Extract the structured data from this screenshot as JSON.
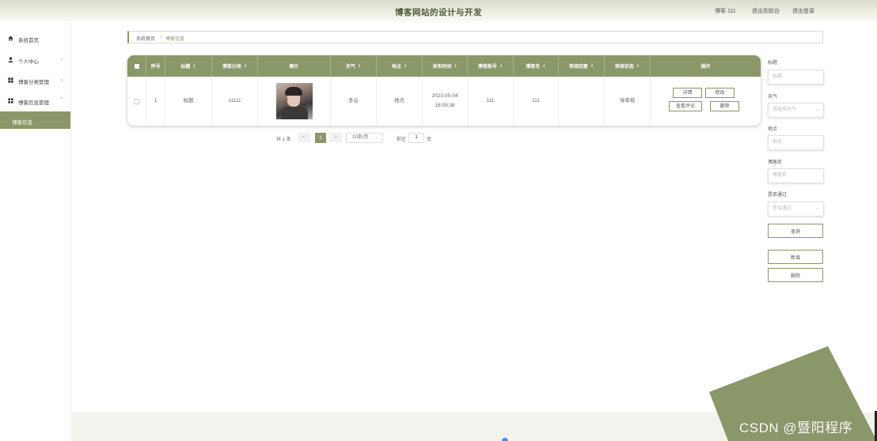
{
  "header": {
    "title": "博客网站的设计与开发",
    "user_label": "博客 111",
    "to_frontend": "退出到前台",
    "logout": "退出登录"
  },
  "sidebar": {
    "items": [
      {
        "label": "系统首页",
        "icon": "home-icon",
        "expandable": false
      },
      {
        "label": "个人中心",
        "icon": "user-icon",
        "expandable": true
      },
      {
        "label": "博客分类管理",
        "icon": "grid-icon",
        "expandable": true
      },
      {
        "label": "博客信息管理",
        "icon": "apps-icon",
        "expandable": true,
        "expanded": true
      }
    ],
    "active_sub": "博客信息"
  },
  "breadcrumb": {
    "home": "系统首页",
    "separator": "/",
    "current": "博客信息"
  },
  "table": {
    "columns": [
      "序号",
      "标题",
      "博客分类",
      "图片",
      "天气",
      "地点",
      "发布时间",
      "博客账号",
      "博客名",
      "审核回复",
      "审核状态",
      "操作"
    ],
    "rows": [
      {
        "index": "1",
        "title": "标题",
        "category": "11111",
        "weather": "多云",
        "location": "地点",
        "publish_time": "2023-05-04 16:09:38",
        "account": "111",
        "blog_name": "111",
        "review_reply": "",
        "review_status": "待审核",
        "actions": {
          "detail": "详情",
          "edit": "修改",
          "comments": "查看评论",
          "delete": "删除"
        }
      }
    ]
  },
  "pagination": {
    "total": "共 1 条",
    "prev": "<",
    "current_page": "1",
    "next": ">",
    "page_size": "10条/页",
    "goto_prefix": "前往",
    "goto_value": "1",
    "goto_suffix": "页"
  },
  "search_panel": {
    "title_label": "标题",
    "title_placeholder": "标题",
    "weather_label": "天气",
    "weather_placeholder": "请选择天气",
    "location_label": "地点",
    "location_placeholder": "地点",
    "blog_name_label": "博客名",
    "blog_name_placeholder": "博客名",
    "approved_label": "是否通过",
    "approved_placeholder": "是否通过",
    "search_button": "查询",
    "add_button": "新增",
    "delete_button": "删除"
  },
  "watermark": "CSDN @暨阳程序",
  "colors": {
    "accent": "#8a9768",
    "header_title": "#4e5a34"
  }
}
